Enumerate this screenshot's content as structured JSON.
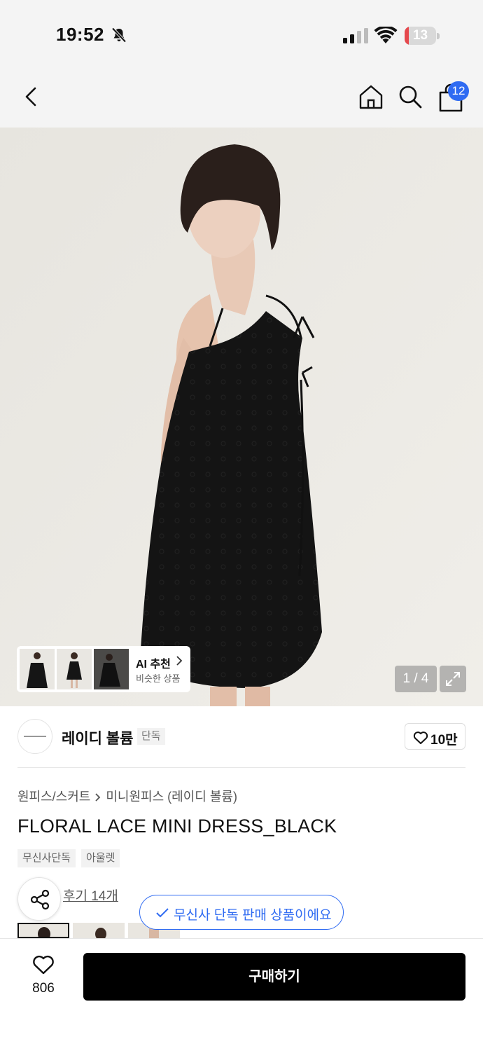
{
  "status_bar": {
    "time": "19:52",
    "battery_level": "13"
  },
  "nav": {
    "cart_badge": "12"
  },
  "hero": {
    "ai_card": {
      "title": "AI 추천",
      "subtitle": "비슷한 상품"
    },
    "page_indicator": "1 / 4"
  },
  "brand": {
    "name": "레이디 볼륨",
    "tag": "단독",
    "like_count": "10만"
  },
  "product": {
    "breadcrumb": [
      "원피스/스커트",
      "미니원피스 (레이디 볼륨)"
    ],
    "title": "FLORAL LACE MINI DRESS_BLACK",
    "tags": [
      "무신사단독",
      "아울렛"
    ],
    "review_link": "후기 14개"
  },
  "toast": {
    "text": "무신사 단독 판매 상품이에요"
  },
  "bottom_bar": {
    "wish_count": "806",
    "buy_label": "구매하기"
  },
  "colors": {
    "accent": "#2f6bf2",
    "buy_button": "#000000",
    "battery_low": "#e5484d"
  }
}
